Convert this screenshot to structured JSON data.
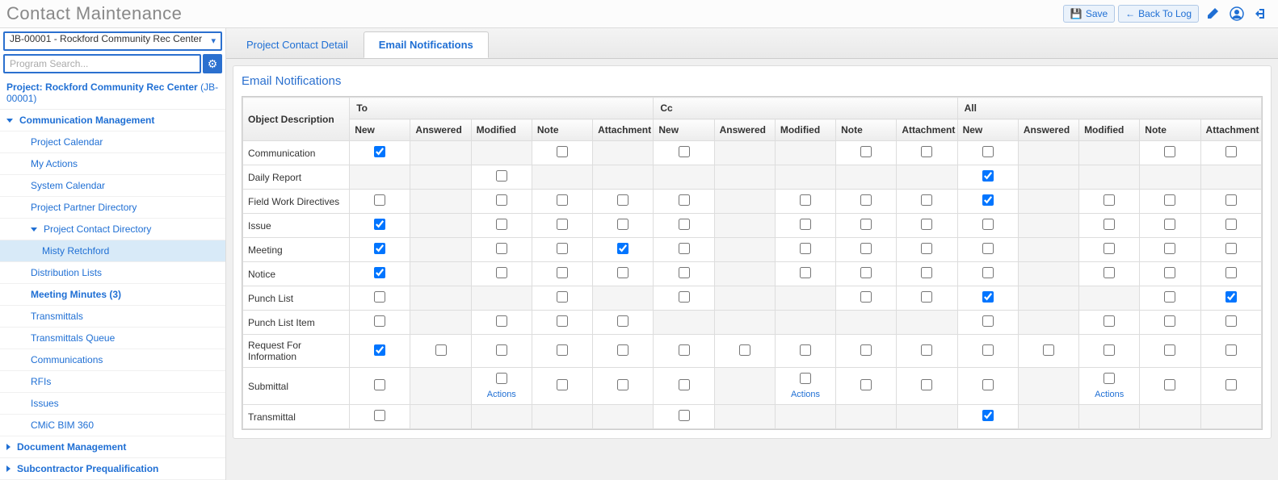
{
  "header": {
    "title": "Contact Maintenance",
    "save_label": "Save",
    "back_label": "Back To Log"
  },
  "sidebar": {
    "project_selected": "JB-00001 - Rockford Community Rec Center",
    "search_placeholder": "Program Search...",
    "project_label_prefix": "Project:",
    "project_label_name": "Rockford Community Rec Center",
    "project_label_code": "(JB-00001)",
    "tree": [
      {
        "label": "Communication Management",
        "level": 0,
        "expanded": true,
        "bold": true
      },
      {
        "label": "Project Calendar",
        "level": 1
      },
      {
        "label": "My Actions",
        "level": 1
      },
      {
        "label": "System Calendar",
        "level": 1
      },
      {
        "label": "Project Partner Directory",
        "level": 1
      },
      {
        "label": "Project Contact Directory",
        "level": 1,
        "expanded": true
      },
      {
        "label": "Misty Retchford",
        "level": 2,
        "selected": true
      },
      {
        "label": "Distribution Lists",
        "level": 1
      },
      {
        "label": "Meeting Minutes (3)",
        "level": 1,
        "bold": true
      },
      {
        "label": "Transmittals",
        "level": 1
      },
      {
        "label": "Transmittals Queue",
        "level": 1
      },
      {
        "label": "Communications",
        "level": 1
      },
      {
        "label": "RFIs",
        "level": 1
      },
      {
        "label": "Issues",
        "level": 1
      },
      {
        "label": "CMiC BIM 360",
        "level": 1
      },
      {
        "label": "Document Management",
        "level": 0,
        "collapsed": true,
        "bold": true
      },
      {
        "label": "Subcontractor Prequalification",
        "level": 0,
        "collapsed": true,
        "bold": true
      }
    ]
  },
  "tabs": [
    {
      "label": "Project Contact Detail",
      "active": false
    },
    {
      "label": "Email Notifications",
      "active": true
    }
  ],
  "panel": {
    "title": "Email Notifications",
    "actions_label": "Actions",
    "groups": [
      "To",
      "Cc",
      "All"
    ],
    "subcols": [
      "New",
      "Answered",
      "Modified",
      "Note",
      "Attachment"
    ],
    "obj_header": "Object Description",
    "rows": [
      {
        "obj": "Communication",
        "cells": [
          {
            "present": true,
            "checked": true
          },
          {
            "present": false
          },
          {
            "present": false
          },
          {
            "present": true
          },
          {
            "present": false
          },
          {
            "present": true
          },
          {
            "present": false
          },
          {
            "present": false
          },
          {
            "present": true
          },
          {
            "present": true
          },
          {
            "present": true
          },
          {
            "present": false
          },
          {
            "present": false
          },
          {
            "present": true
          },
          {
            "present": true
          }
        ]
      },
      {
        "obj": "Daily Report",
        "cells": [
          {
            "present": false
          },
          {
            "present": false
          },
          {
            "present": true
          },
          {
            "present": false
          },
          {
            "present": false
          },
          {
            "present": false
          },
          {
            "present": false
          },
          {
            "present": false
          },
          {
            "present": false
          },
          {
            "present": false
          },
          {
            "present": true,
            "checked": true
          },
          {
            "present": false
          },
          {
            "present": false
          },
          {
            "present": false
          },
          {
            "present": false
          }
        ]
      },
      {
        "obj": "Field Work Directives",
        "cells": [
          {
            "present": true
          },
          {
            "present": false
          },
          {
            "present": true
          },
          {
            "present": true
          },
          {
            "present": true
          },
          {
            "present": true
          },
          {
            "present": false
          },
          {
            "present": true
          },
          {
            "present": true
          },
          {
            "present": true
          },
          {
            "present": true,
            "checked": true
          },
          {
            "present": false
          },
          {
            "present": true
          },
          {
            "present": true
          },
          {
            "present": true
          }
        ]
      },
      {
        "obj": "Issue",
        "cells": [
          {
            "present": true,
            "checked": true
          },
          {
            "present": false
          },
          {
            "present": true
          },
          {
            "present": true
          },
          {
            "present": true
          },
          {
            "present": true
          },
          {
            "present": false
          },
          {
            "present": true
          },
          {
            "present": true
          },
          {
            "present": true
          },
          {
            "present": true
          },
          {
            "present": false
          },
          {
            "present": true
          },
          {
            "present": true
          },
          {
            "present": true
          }
        ]
      },
      {
        "obj": "Meeting",
        "cells": [
          {
            "present": true,
            "checked": true
          },
          {
            "present": false
          },
          {
            "present": true
          },
          {
            "present": true
          },
          {
            "present": true,
            "checked": true
          },
          {
            "present": true
          },
          {
            "present": false
          },
          {
            "present": true
          },
          {
            "present": true
          },
          {
            "present": true
          },
          {
            "present": true
          },
          {
            "present": false
          },
          {
            "present": true
          },
          {
            "present": true
          },
          {
            "present": true
          }
        ]
      },
      {
        "obj": "Notice",
        "cells": [
          {
            "present": true,
            "checked": true
          },
          {
            "present": false
          },
          {
            "present": true
          },
          {
            "present": true
          },
          {
            "present": true
          },
          {
            "present": true
          },
          {
            "present": false
          },
          {
            "present": true
          },
          {
            "present": true
          },
          {
            "present": true
          },
          {
            "present": true
          },
          {
            "present": false
          },
          {
            "present": true
          },
          {
            "present": true
          },
          {
            "present": true
          }
        ]
      },
      {
        "obj": "Punch List",
        "cells": [
          {
            "present": true
          },
          {
            "present": false
          },
          {
            "present": false
          },
          {
            "present": true
          },
          {
            "present": false
          },
          {
            "present": true
          },
          {
            "present": false
          },
          {
            "present": false
          },
          {
            "present": true
          },
          {
            "present": true
          },
          {
            "present": true,
            "checked": true
          },
          {
            "present": false
          },
          {
            "present": false
          },
          {
            "present": true
          },
          {
            "present": true,
            "checked": true
          }
        ]
      },
      {
        "obj": "Punch List Item",
        "cells": [
          {
            "present": true
          },
          {
            "present": false
          },
          {
            "present": true
          },
          {
            "present": true
          },
          {
            "present": true
          },
          {
            "present": false
          },
          {
            "present": false
          },
          {
            "present": false
          },
          {
            "present": false
          },
          {
            "present": false
          },
          {
            "present": true
          },
          {
            "present": false
          },
          {
            "present": true
          },
          {
            "present": true
          },
          {
            "present": true
          }
        ]
      },
      {
        "obj": "Request For Information",
        "cells": [
          {
            "present": true,
            "checked": true
          },
          {
            "present": true
          },
          {
            "present": true
          },
          {
            "present": true
          },
          {
            "present": true
          },
          {
            "present": true
          },
          {
            "present": true
          },
          {
            "present": true
          },
          {
            "present": true
          },
          {
            "present": true
          },
          {
            "present": true
          },
          {
            "present": true
          },
          {
            "present": true
          },
          {
            "present": true
          },
          {
            "present": true
          }
        ]
      },
      {
        "obj": "Submittal",
        "cells": [
          {
            "present": true
          },
          {
            "present": false
          },
          {
            "present": true,
            "actions": true
          },
          {
            "present": true
          },
          {
            "present": true
          },
          {
            "present": true
          },
          {
            "present": false
          },
          {
            "present": true,
            "actions": true
          },
          {
            "present": true
          },
          {
            "present": true
          },
          {
            "present": true
          },
          {
            "present": false
          },
          {
            "present": true,
            "actions": true
          },
          {
            "present": true
          },
          {
            "present": true
          }
        ]
      },
      {
        "obj": "Transmittal",
        "cells": [
          {
            "present": true
          },
          {
            "present": false
          },
          {
            "present": false
          },
          {
            "present": false
          },
          {
            "present": false
          },
          {
            "present": true
          },
          {
            "present": false
          },
          {
            "present": false
          },
          {
            "present": false
          },
          {
            "present": false
          },
          {
            "present": true,
            "checked": true
          },
          {
            "present": false
          },
          {
            "present": false
          },
          {
            "present": false
          },
          {
            "present": false
          }
        ]
      }
    ]
  }
}
